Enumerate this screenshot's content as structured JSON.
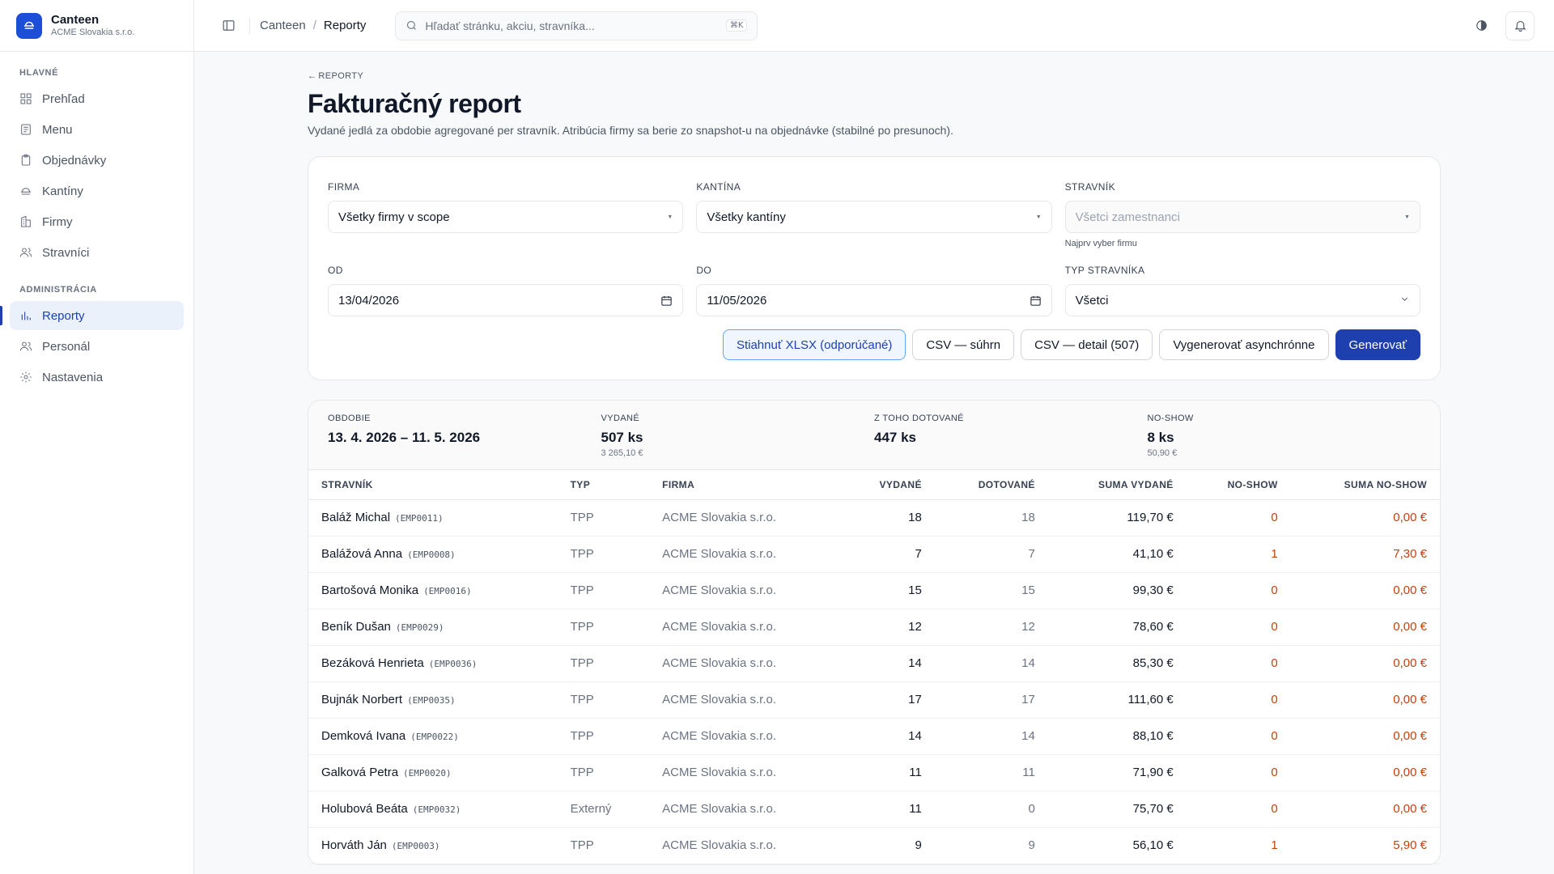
{
  "brand": {
    "name": "Canteen",
    "org": "ACME Slovakia s.r.o."
  },
  "sidebar": {
    "sections": [
      {
        "heading": "Hlavné",
        "items": [
          {
            "label": "Prehľad",
            "icon": "dashboard-icon"
          },
          {
            "label": "Menu",
            "icon": "menu-icon"
          },
          {
            "label": "Objednávky",
            "icon": "clipboard-icon"
          },
          {
            "label": "Kantíny",
            "icon": "canteen-icon"
          },
          {
            "label": "Firmy",
            "icon": "building-icon"
          },
          {
            "label": "Stravníci",
            "icon": "users-icon"
          }
        ]
      },
      {
        "heading": "Administrácia",
        "items": [
          {
            "label": "Reporty",
            "icon": "chart-icon",
            "active": true
          },
          {
            "label": "Personál",
            "icon": "users-icon"
          },
          {
            "label": "Nastavenia",
            "icon": "gear-icon"
          }
        ]
      }
    ]
  },
  "topbar": {
    "breadcrumb": [
      "Canteen",
      "Reporty"
    ],
    "search_placeholder": "Hľadať stránku, akciu, stravníka...",
    "search_shortcut": "⌘K"
  },
  "page": {
    "back_label": "REPORTY",
    "title": "Fakturačný report",
    "description": "Vydané jedlá za obdobie agregované per stravník. Atribúcia firmy sa berie zo snapshot-u na objednávke (stabilné po presunoch)."
  },
  "filters": {
    "firma": {
      "label": "Firma",
      "value": "Všetky firmy v scope"
    },
    "kantina": {
      "label": "Kantína",
      "value": "Všetky kantíny"
    },
    "stravnik": {
      "label": "Stravník",
      "placeholder": "Všetci zamestnanci",
      "hint": "Najprv vyber firmu"
    },
    "od": {
      "label": "Od",
      "value": "13/04/2026"
    },
    "do": {
      "label": "Do",
      "value": "11/05/2026"
    },
    "typ": {
      "label": "Typ stravníka",
      "value": "Všetci"
    }
  },
  "actions": {
    "xlsx": "Stiahnuť XLSX (odporúčané)",
    "csv_sum": "CSV — súhrn",
    "csv_detail": "CSV — detail (507)",
    "async": "Vygenerovať asynchrónne",
    "generate": "Generovať"
  },
  "summary": {
    "obdobie": {
      "label": "Obdobie",
      "value": "13. 4. 2026 – 11. 5. 2026"
    },
    "vydane": {
      "label": "Vydané",
      "value": "507 ks",
      "sub": "3 265,10 €"
    },
    "dotovane": {
      "label": "Z toho dotované",
      "value": "447 ks"
    },
    "noshow": {
      "label": "No-show",
      "value": "8 ks",
      "sub": "50,90 €"
    }
  },
  "table": {
    "headers": [
      "Stravník",
      "Typ",
      "Firma",
      "Vydané",
      "Dotované",
      "Suma vydané",
      "No-show",
      "Suma no-show"
    ],
    "rows": [
      {
        "name": "Baláž Michal",
        "code": "(EMP0011)",
        "typ": "TPP",
        "firma": "ACME Slovakia s.r.o.",
        "vydane": "18",
        "dotovane": "18",
        "suma": "119,70 €",
        "noshow": "0",
        "suma_noshow": "0,00 €"
      },
      {
        "name": "Balážová Anna",
        "code": "(EMP0008)",
        "typ": "TPP",
        "firma": "ACME Slovakia s.r.o.",
        "vydane": "7",
        "dotovane": "7",
        "suma": "41,10 €",
        "noshow": "1",
        "suma_noshow": "7,30 €"
      },
      {
        "name": "Bartošová Monika",
        "code": "(EMP0016)",
        "typ": "TPP",
        "firma": "ACME Slovakia s.r.o.",
        "vydane": "15",
        "dotovane": "15",
        "suma": "99,30 €",
        "noshow": "0",
        "suma_noshow": "0,00 €"
      },
      {
        "name": "Beník Dušan",
        "code": "(EMP0029)",
        "typ": "TPP",
        "firma": "ACME Slovakia s.r.o.",
        "vydane": "12",
        "dotovane": "12",
        "suma": "78,60 €",
        "noshow": "0",
        "suma_noshow": "0,00 €"
      },
      {
        "name": "Bezáková Henrieta",
        "code": "(EMP0036)",
        "typ": "TPP",
        "firma": "ACME Slovakia s.r.o.",
        "vydane": "14",
        "dotovane": "14",
        "suma": "85,30 €",
        "noshow": "0",
        "suma_noshow": "0,00 €"
      },
      {
        "name": "Bujnák Norbert",
        "code": "(EMP0035)",
        "typ": "TPP",
        "firma": "ACME Slovakia s.r.o.",
        "vydane": "17",
        "dotovane": "17",
        "suma": "111,60 €",
        "noshow": "0",
        "suma_noshow": "0,00 €"
      },
      {
        "name": "Demková Ivana",
        "code": "(EMP0022)",
        "typ": "TPP",
        "firma": "ACME Slovakia s.r.o.",
        "vydane": "14",
        "dotovane": "14",
        "suma": "88,10 €",
        "noshow": "0",
        "suma_noshow": "0,00 €"
      },
      {
        "name": "Galková Petra",
        "code": "(EMP0020)",
        "typ": "TPP",
        "firma": "ACME Slovakia s.r.o.",
        "vydane": "11",
        "dotovane": "11",
        "suma": "71,90 €",
        "noshow": "0",
        "suma_noshow": "0,00 €"
      },
      {
        "name": "Holubová Beáta",
        "code": "(EMP0032)",
        "typ": "Externý",
        "firma": "ACME Slovakia s.r.o.",
        "vydane": "11",
        "dotovane": "0",
        "suma": "75,70 €",
        "noshow": "0",
        "suma_noshow": "0,00 €"
      },
      {
        "name": "Horváth Ján",
        "code": "(EMP0003)",
        "typ": "TPP",
        "firma": "ACME Slovakia s.r.o.",
        "vydane": "9",
        "dotovane": "9",
        "suma": "56,10 €",
        "noshow": "1",
        "suma_noshow": "5,90 €"
      }
    ]
  },
  "colors": {
    "accent": "#1e40af",
    "accent_bg": "#eaf1fb",
    "noshow": "#c2410c"
  }
}
